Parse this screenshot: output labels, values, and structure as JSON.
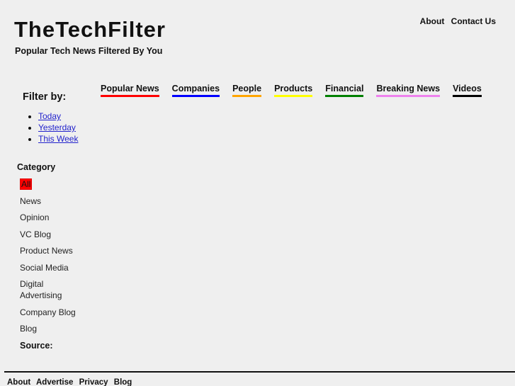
{
  "header": {
    "title": "TheTechFilter",
    "tagline": "Popular Tech News Filtered By You",
    "nav": [
      "About",
      "Contact Us"
    ]
  },
  "topics": [
    {
      "label": "Popular News",
      "color": "#ff0000"
    },
    {
      "label": "Companies",
      "color": "#0000ff"
    },
    {
      "label": "People",
      "color": "#ffa500"
    },
    {
      "label": "Products",
      "color": "#ffff00"
    },
    {
      "label": "Financial",
      "color": "#008000"
    },
    {
      "label": "Breaking News",
      "color": "#ee82ee"
    },
    {
      "label": "Videos",
      "color": "#000000"
    }
  ],
  "sidebar": {
    "filter_title": "Filter by:",
    "filters": [
      "Today",
      "Yesterday",
      "This Week"
    ],
    "category_title": "Category",
    "categories": [
      "All",
      "News",
      "Opinion",
      "VC Blog",
      "Product News",
      "Social Media",
      "Digital Advertising",
      "Company Blog",
      "Blog"
    ],
    "selected_category": "All",
    "selected_color": "#ff0000",
    "source_title": "Source:"
  },
  "footer": {
    "links": [
      "About",
      "Advertise",
      "Privacy",
      "Blog"
    ]
  }
}
